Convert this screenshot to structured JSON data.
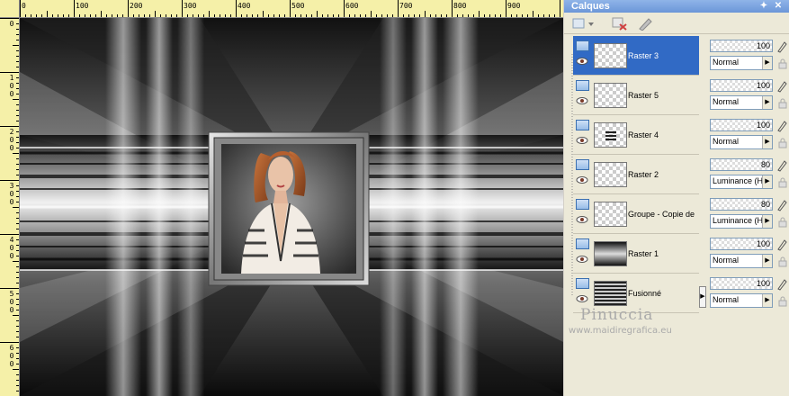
{
  "panel": {
    "title": "Calques"
  },
  "rulers": {
    "horizontal": [
      "0",
      "100",
      "200",
      "300",
      "400",
      "500",
      "600",
      "700",
      "800",
      "900"
    ],
    "vertical": [
      "0",
      "100",
      "200",
      "300",
      "400",
      "500",
      "600"
    ]
  },
  "layers": [
    {
      "name": "Raster 3",
      "opacity": "100",
      "blend": "Normal",
      "selected": true
    },
    {
      "name": "Raster 5",
      "opacity": "100",
      "blend": "Normal",
      "selected": false
    },
    {
      "name": "Raster 4",
      "opacity": "100",
      "blend": "Normal",
      "selected": false
    },
    {
      "name": "Raster 2",
      "opacity": "80",
      "blend": "Luminance (H)",
      "selected": false
    },
    {
      "name": "Groupe - Copie de",
      "opacity": "80",
      "blend": "Luminance (H)",
      "selected": false
    },
    {
      "name": "Raster 1",
      "opacity": "100",
      "blend": "Normal",
      "selected": false
    },
    {
      "name": "Fusionné",
      "opacity": "100",
      "blend": "Normal",
      "selected": false
    }
  ],
  "watermark": {
    "name": "Pinuccia",
    "url": "www.maidiregrafica.eu"
  },
  "colors": {
    "selection": "#316ac5",
    "title_bar": "#7ba2e0",
    "ruler": "#f5f0a8"
  }
}
